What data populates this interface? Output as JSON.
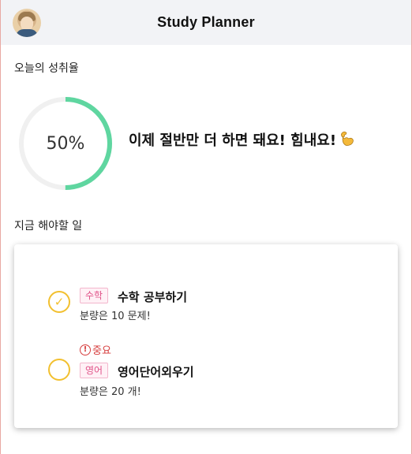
{
  "header": {
    "title": "Study Planner"
  },
  "achievement": {
    "label": "오늘의 성취율",
    "percent": 50,
    "percent_text": "50%",
    "message": "이제 절반만 더 하면 돼요! 힘내요!",
    "ring_color": "#5fd6a0",
    "ring_track_color": "#f0f0f0"
  },
  "tasks_section": {
    "label": "지금 해야할 일",
    "items": [
      {
        "tag": "수학",
        "title": "수학 공부하기",
        "desc": "분량은 10 문제!",
        "done": true,
        "important": false
      },
      {
        "important_text": "중요",
        "tag": "영어",
        "title": "영어단어외우기",
        "desc": "분량은 20 개!",
        "done": false,
        "important": true
      }
    ]
  },
  "colors": {
    "accent_yellow": "#f2c02f",
    "tag_pink": "#e05288",
    "important_red": "#d63b3b",
    "header_bg": "#f2f3f6"
  },
  "icons": {
    "avatar": "avatar",
    "flex_emoji": "flexed-biceps-icon",
    "check": "check-icon",
    "important": "exclamation-circle-icon"
  }
}
